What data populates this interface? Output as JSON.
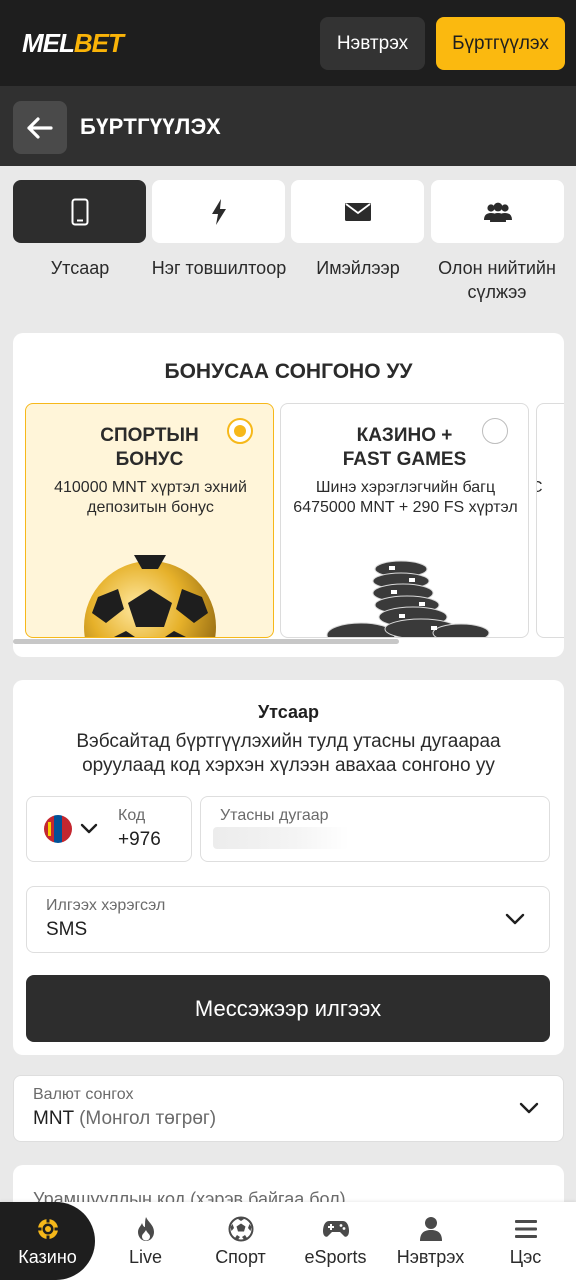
{
  "header": {
    "logo_left": "MEL",
    "logo_right": "BET",
    "login_label": "Нэвтрэх",
    "register_label": "Бүртгүүлэх"
  },
  "titlebar": {
    "title": "БҮРТГҮҮЛЭХ"
  },
  "methods": [
    {
      "label": "Утсаар",
      "icon": "phone-icon"
    },
    {
      "label": "Нэг товшилтоор",
      "icon": "lightning-icon"
    },
    {
      "label": "Имэйлээр",
      "icon": "envelope-icon"
    },
    {
      "label": "Олон нийтийн сүлжээ",
      "icon": "users-icon"
    }
  ],
  "bonus": {
    "title": "БОНУСАА СОНГОНО УУ",
    "options": [
      {
        "title": "СПОРТЫН БОНУС",
        "desc": "410000 MNT хүртэл эхний депозитын бонус",
        "selected": true
      },
      {
        "title": "КАЗИНО + FAST GAMES",
        "desc": "Шинэ хэрэглэгчийн багц 6475000 MNT + 290 FS хүртэл",
        "selected": false
      },
      {
        "title": "",
        "desc": "С",
        "selected": false
      }
    ]
  },
  "phone": {
    "title": "Утсаар",
    "desc": "Вэбсайтад бүртгүүлэхийн тулд утасны дугаараа оруулаад код хэрхэн хүлээн авахаа сонгоно уу",
    "code_label": "Код",
    "code_value": "+976",
    "number_placeholder": "Утасны дугаар",
    "send_method_label": "Илгээх хэрэгсэл",
    "send_method_value": "SMS",
    "send_button": "Мессэжээр илгээх"
  },
  "currency": {
    "label": "Валют сонгох",
    "code": "MNT",
    "name": "(Монгол төгрөг)"
  },
  "promo": {
    "label": "Урамшууллын код (хэрэв байгаа бол)"
  },
  "nav": [
    {
      "label": "Казино",
      "icon": "casino-chip-icon",
      "active": true
    },
    {
      "label": "Live",
      "icon": "fire-icon",
      "active": false
    },
    {
      "label": "Спорт",
      "icon": "soccer-ball-icon",
      "active": false
    },
    {
      "label": "eSports",
      "icon": "gamepad-icon",
      "active": false
    },
    {
      "label": "Нэвтрэх",
      "icon": "user-icon",
      "active": false
    },
    {
      "label": "Цэс",
      "icon": "menu-icon",
      "active": false
    }
  ],
  "colors": {
    "accent": "#fbb90f",
    "dark": "#1e1e1e",
    "selected_bg": "#fff5d9"
  }
}
